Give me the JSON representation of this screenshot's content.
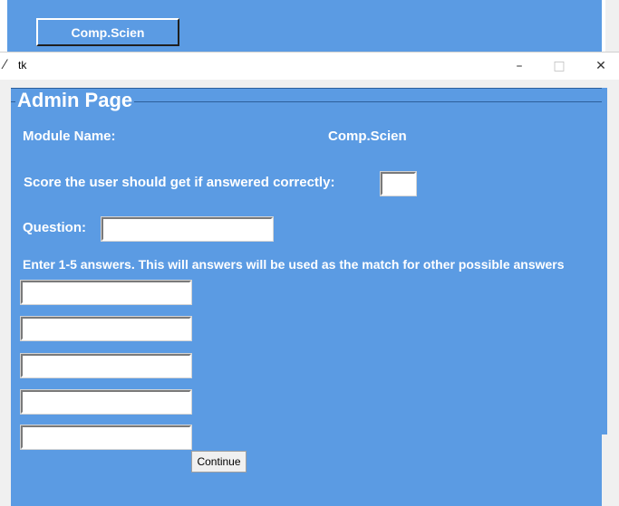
{
  "background_window": {
    "button_label": "Comp.Scien"
  },
  "window": {
    "title": "tk",
    "controls": {
      "minimize": "–",
      "maximize": "□",
      "close": "✕"
    }
  },
  "frame": {
    "title": "Admin Page"
  },
  "form": {
    "module_label": "Module Name:",
    "module_value": "Comp.Scien",
    "score_label": "Score the user should get if  answered correctly:",
    "score_value": "",
    "question_label": "Question:",
    "question_value": "",
    "answers_instruction": "Enter 1-5 answers. This will answers will be used as the match for other possible answers",
    "answers": [
      "",
      "",
      "",
      "",
      ""
    ],
    "continue_label": "Continue"
  },
  "colors": {
    "panel_bg": "#5b9be3",
    "label_text": "#ffffff",
    "client_bg": "#f0f0f0"
  }
}
